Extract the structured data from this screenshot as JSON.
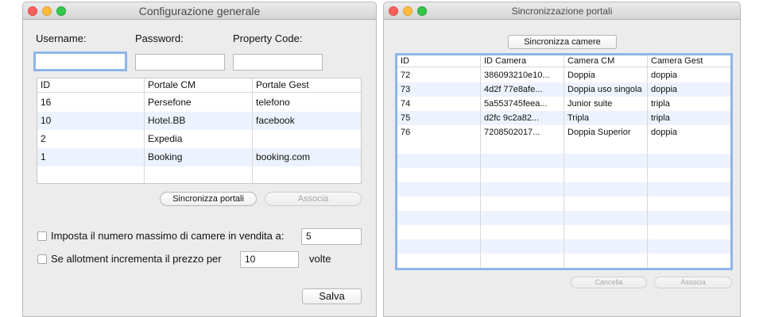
{
  "left_window": {
    "title": "Configurazione generale",
    "username_label": "Username:",
    "password_label": "Password:",
    "property_code_label": "Property Code:",
    "username_value": "",
    "password_value": "",
    "property_code_value": "",
    "table": {
      "headers": [
        "ID",
        "Portale CM",
        "Portale Gest"
      ],
      "rows": [
        [
          "16",
          "Persefone",
          "telefono"
        ],
        [
          "10",
          "Hotel.BB",
          "facebook"
        ],
        [
          "2",
          "Expedia",
          ""
        ],
        [
          "1",
          "Booking",
          "booking.com"
        ]
      ]
    },
    "sync_button": "Sincronizza portali",
    "associa_button": "Associa",
    "max_rooms_label": "Imposta il numero massimo di camere in vendita a:",
    "max_rooms_value": "5",
    "allotment_label": "Se allotment incrementa il prezzo per",
    "allotment_value": "10",
    "volte_label": "volte",
    "save_button": "Salva"
  },
  "right_window": {
    "title": "Sincronizzazione portali",
    "sync_rooms_button": "Sincronizza camere",
    "table": {
      "headers": [
        "ID",
        "ID Camera",
        "Camera CM",
        "Camera Gest"
      ],
      "rows": [
        [
          "72",
          "386093210e10...",
          "Doppia",
          "doppia"
        ],
        [
          "73",
          "4d2f        77e8afe...",
          "Doppia uso singola",
          "doppia"
        ],
        [
          "74",
          "5a553745feea...",
          "Junior suite",
          "tripla"
        ],
        [
          "75",
          "d2fc        9c2a82...",
          "Tripla",
          "tripla"
        ],
        [
          "76",
          "7208502017...",
          "Doppia Superior",
          "doppia"
        ]
      ]
    },
    "cancel_button": "Cancella",
    "associa_button": "Associa"
  }
}
